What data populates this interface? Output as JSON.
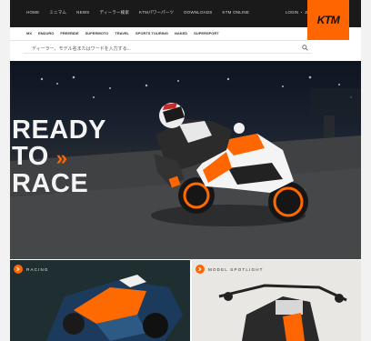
{
  "nav": {
    "items": [
      "HOME",
      "ミニマム",
      "NEWS",
      "ディーラー検索",
      "KTMパワーパーツ",
      "DOWNLOADS",
      "KTM ONLINE"
    ],
    "util": "LOGIN ・ JP",
    "logo": "KTM"
  },
  "subnav": {
    "items": [
      "MX",
      "ENDURO",
      "FREERIDE",
      "SUPERMOTO",
      "TRAVEL",
      "SPORTS TOURING",
      "NAKED",
      "SUPERSPORT"
    ]
  },
  "search": {
    "placeholder": "ディーラー、モデル名またはワードを入力する..."
  },
  "hero": {
    "headline": [
      "READY",
      "TO",
      "RACE"
    ],
    "chevron": "»"
  },
  "sections": [
    {
      "label": "RACING"
    },
    {
      "label": "MODEL SPOTLIGHT"
    }
  ],
  "colors": {
    "brand_orange": "#ff6600",
    "nav_dark": "#1a1a1a"
  }
}
